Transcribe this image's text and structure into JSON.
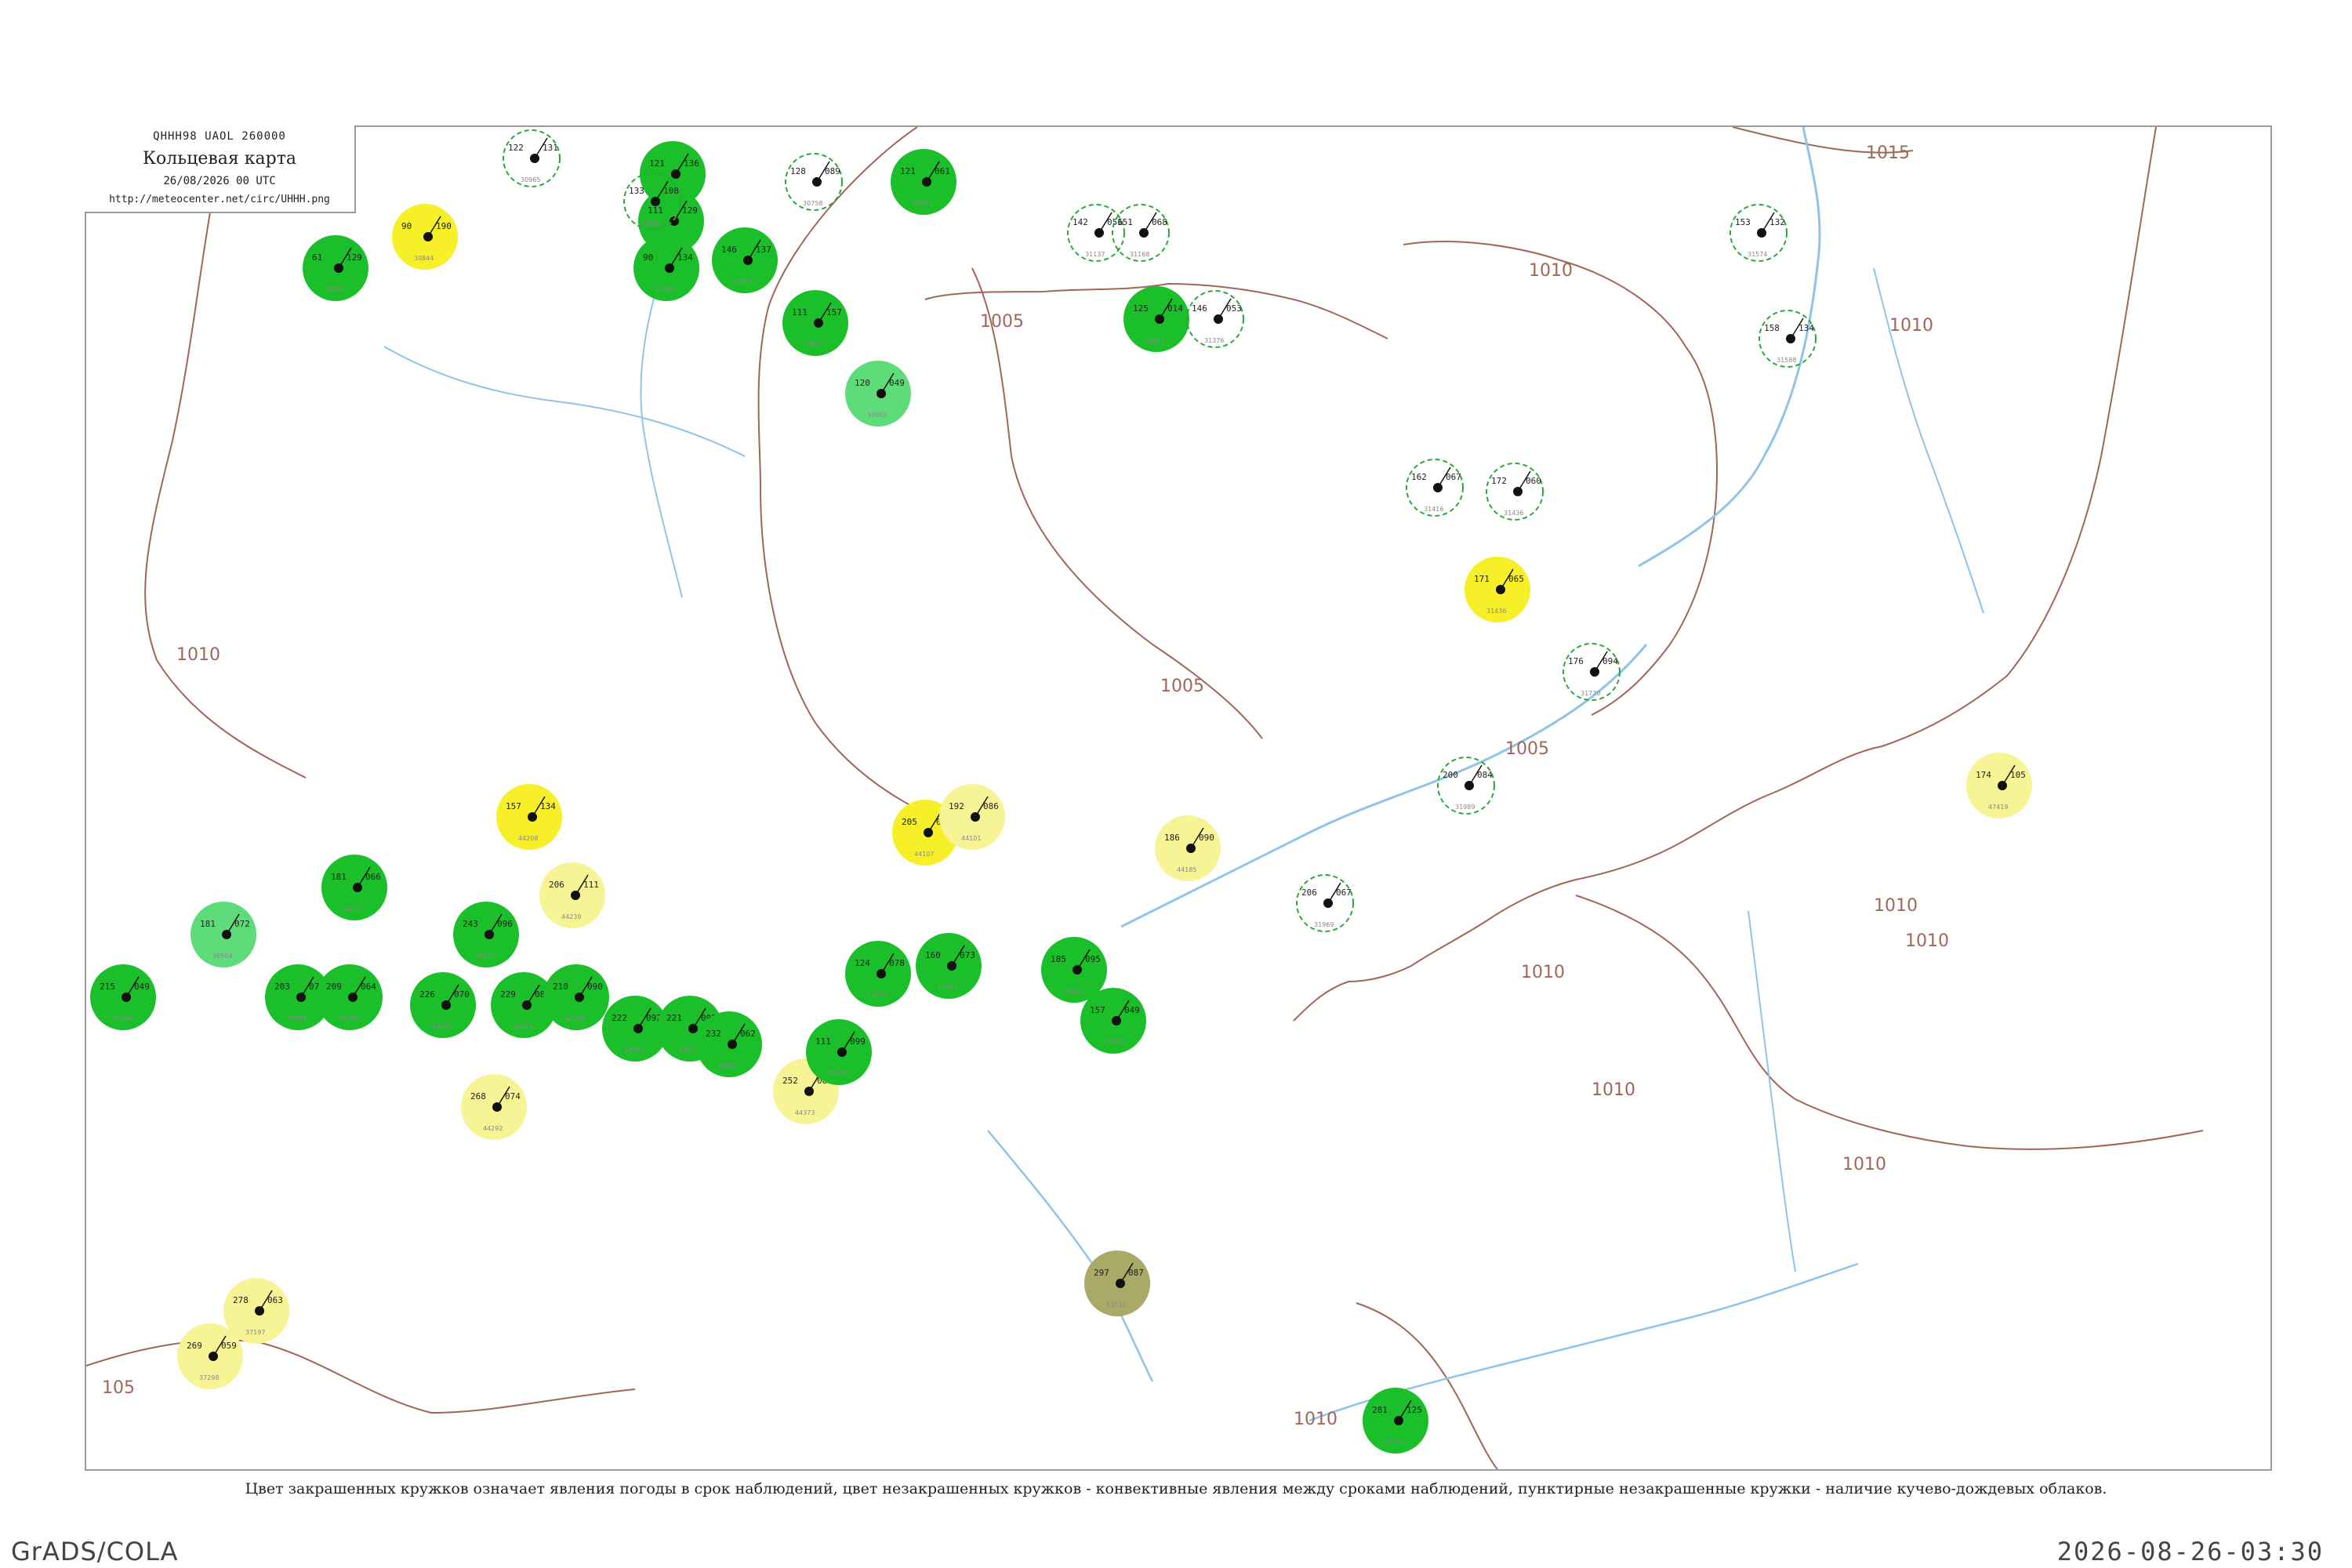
{
  "header": {
    "code": "QHHH98  UAOL  260000",
    "title": "Кольцевая карта",
    "datetime": "26/08/2026 00 UTC",
    "url": "http://meteocenter.net/circ/UHHH.png"
  },
  "caption": "Цвет закрашенных кружков означает явления погоды в срок наблюдений, цвет незакрашенных кружков - конвективные явления между сроками наблюдений, пунктирные незакрашенные кружки - наличие кучево-дождевых облаков.",
  "footer": {
    "left": "GrADS/COLA",
    "right": "2026-08-26-03:30"
  },
  "colors": {
    "isobar": "#a0665a",
    "water": "#8fc4e8",
    "rain": "#1bbf2a",
    "rain_light": "#5fdc7a",
    "fog_haze": "#f7f028",
    "haze_light": "#f6f494",
    "dust": "#a9a968",
    "cb_dashed": "#2aa83a"
  },
  "isobars": [
    {
      "label": "1015"
    },
    {
      "label": "1010"
    },
    {
      "label": "1005"
    },
    {
      "label": "1005"
    },
    {
      "label": "1005"
    },
    {
      "label": "1010"
    },
    {
      "label": "1010"
    },
    {
      "label": "1010"
    },
    {
      "label": "1010"
    },
    {
      "label": "1010"
    },
    {
      "label": "1010"
    },
    {
      "label": "1010"
    },
    {
      "label": "1010"
    },
    {
      "label": "105"
    }
  ],
  "stations": [
    {
      "kind": "rain",
      "t": "61",
      "p": "129",
      "id": "30052"
    },
    {
      "kind": "haze",
      "t": "90",
      "p": "190",
      "id": "30844"
    },
    {
      "kind": "rain",
      "t": "121",
      "p": "136",
      "id": "30550"
    },
    {
      "kind": "rain",
      "t": "111",
      "p": "129",
      "id": "31004"
    },
    {
      "kind": "rain",
      "t": "90",
      "p": "134",
      "id": "31004"
    },
    {
      "kind": "rain",
      "t": "146",
      "p": "137",
      "id": "30871"
    },
    {
      "kind": "rain",
      "t": "111",
      "p": "157",
      "id": "30871"
    },
    {
      "kind": "rain_light",
      "t": "120",
      "p": "049",
      "id": "30965"
    },
    {
      "kind": "rain",
      "t": "121",
      "p": "061",
      "id": "30971"
    },
    {
      "kind": "rain",
      "t": "125",
      "p": "014",
      "id": "30971"
    },
    {
      "kind": "haze",
      "t": "157",
      "p": "134",
      "id": "44208"
    },
    {
      "kind": "haze_light",
      "t": "206",
      "p": "111",
      "id": "44239"
    },
    {
      "kind": "haze",
      "t": "205",
      "p": "084",
      "id": "44107"
    },
    {
      "kind": "haze_light",
      "t": "192",
      "p": "086",
      "id": "44101"
    },
    {
      "kind": "haze_light",
      "t": "186",
      "p": "090",
      "id": "44185"
    },
    {
      "kind": "rain",
      "t": "181",
      "p": "066",
      "id": "44212"
    },
    {
      "kind": "rain_light",
      "t": "181",
      "p": "072",
      "id": "36564"
    },
    {
      "kind": "rain",
      "t": "215",
      "p": "049",
      "id": "35946"
    },
    {
      "kind": "rain",
      "t": "203",
      "p": "075",
      "id": "35849"
    },
    {
      "kind": "rain",
      "t": "209",
      "p": "064",
      "id": "36055"
    },
    {
      "kind": "rain",
      "t": "243",
      "p": "096",
      "id": "44212"
    },
    {
      "kind": "haze_light",
      "t": "268",
      "p": "074",
      "id": "44292"
    },
    {
      "kind": "rain",
      "t": "226",
      "p": "070",
      "id": "44287"
    },
    {
      "kind": "rain",
      "t": "229",
      "p": "083",
      "id": "44294"
    },
    {
      "kind": "rain",
      "t": "210",
      "p": "090",
      "id": "44298"
    },
    {
      "kind": "rain",
      "t": "222",
      "p": "092",
      "id": "44305"
    },
    {
      "kind": "rain",
      "t": "221",
      "p": "092",
      "id": "44313"
    },
    {
      "kind": "rain",
      "t": "232",
      "p": "062",
      "id": "44341"
    },
    {
      "kind": "haze_light",
      "t": "252",
      "p": "083",
      "id": "44373"
    },
    {
      "kind": "haze_light",
      "t": "278",
      "p": "063",
      "id": "37197"
    },
    {
      "kind": "haze_light",
      "t": "269",
      "p": "059",
      "id": "37298"
    },
    {
      "kind": "dust",
      "t": "297",
      "p": "087",
      "id": "53512"
    },
    {
      "kind": "rain",
      "t": "281",
      "p": "125",
      "id": "47132"
    },
    {
      "kind": "haze",
      "t": "171",
      "p": "065",
      "id": "31436"
    },
    {
      "kind": "haze_light",
      "t": "174",
      "p": "105",
      "id": "47419"
    },
    {
      "kind": "rain",
      "t": "124",
      "p": "078",
      "id": "31873"
    },
    {
      "kind": "rain",
      "t": "111",
      "p": "099",
      "id": "31873"
    },
    {
      "kind": "rain",
      "t": "160",
      "p": "073",
      "id": "31901"
    },
    {
      "kind": "rain",
      "t": "185",
      "p": "095",
      "id": "31960"
    },
    {
      "kind": "rain",
      "t": "157",
      "p": "049",
      "id": "31909"
    },
    {
      "kind": "cb",
      "t": "122",
      "p": "131",
      "id": "30965"
    },
    {
      "kind": "cb",
      "t": "133",
      "p": "108",
      "id": "30992"
    },
    {
      "kind": "cb",
      "t": "128",
      "p": "089",
      "id": "30758"
    },
    {
      "kind": "cb",
      "t": "142",
      "p": "056",
      "id": "31137"
    },
    {
      "kind": "cb",
      "t": "151",
      "p": "068",
      "id": "31168"
    },
    {
      "kind": "cb",
      "t": "146",
      "p": "053",
      "id": "31376"
    },
    {
      "kind": "cb",
      "t": "162",
      "p": "067",
      "id": "31416"
    },
    {
      "kind": "cb",
      "t": "172",
      "p": "060",
      "id": "31436"
    },
    {
      "kind": "cb",
      "t": "153",
      "p": "132",
      "id": "31574"
    },
    {
      "kind": "cb",
      "t": "158",
      "p": "134",
      "id": "31588"
    },
    {
      "kind": "cb",
      "t": "176",
      "p": "094",
      "id": "31770"
    },
    {
      "kind": "cb",
      "t": "200",
      "p": "084",
      "id": "31989"
    },
    {
      "kind": "cb",
      "t": "206",
      "p": "067",
      "id": "31969"
    }
  ]
}
